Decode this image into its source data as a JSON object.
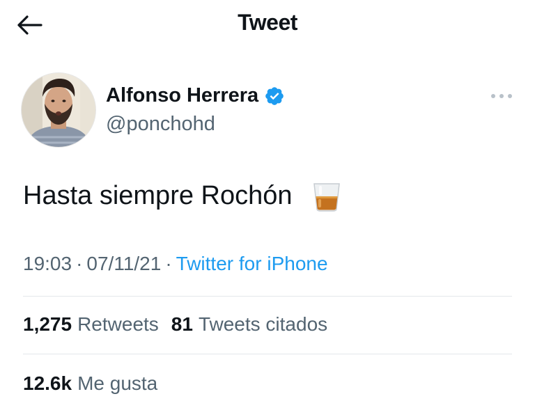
{
  "header": {
    "title": "Tweet",
    "back_icon": "arrow-left-icon"
  },
  "author": {
    "name": "Alfonso Herrera",
    "handle": "@ponchohd",
    "verified": true,
    "verified_color": "#1d9bf0",
    "more_icon": "more-horizontal-icon"
  },
  "tweet": {
    "text": "Hasta siempre Rochón",
    "emoji": "tumbler-glass-emoji"
  },
  "meta": {
    "time": "19:03",
    "separator": "·",
    "date": "07/11/21",
    "source": "Twitter for iPhone",
    "source_color": "#1d9bf0"
  },
  "stats": {
    "retweets_count": "1,275",
    "retweets_label": "Retweets",
    "quotes_count": "81",
    "quotes_label": "Tweets citados",
    "likes_count": "12.6k",
    "likes_label": "Me gusta"
  }
}
